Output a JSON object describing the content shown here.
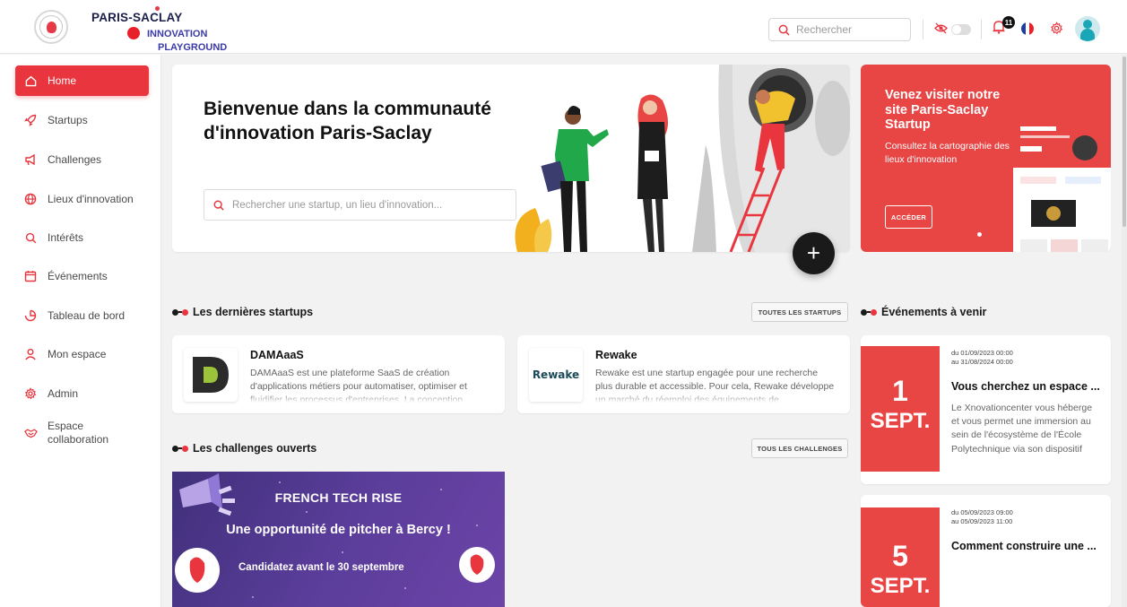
{
  "header": {
    "brand_line1": "PARIS-SACLAY",
    "brand_line2": "INNOVATION",
    "brand_line3": "PLAYGROUND",
    "search_placeholder": "Rechercher",
    "notification_count": "11"
  },
  "sidebar": {
    "items": [
      {
        "label": "Home",
        "icon": "home-icon",
        "active": true
      },
      {
        "label": "Startups",
        "icon": "rocket-icon"
      },
      {
        "label": "Challenges",
        "icon": "megaphone-icon"
      },
      {
        "label": "Lieux d'innovation",
        "icon": "globe-icon"
      },
      {
        "label": "Intérêts",
        "icon": "search-icon"
      },
      {
        "label": "Événements",
        "icon": "calendar-icon"
      },
      {
        "label": "Tableau de bord",
        "icon": "pie-chart-icon"
      },
      {
        "label": "Mon espace",
        "icon": "user-icon"
      },
      {
        "label": "Admin",
        "icon": "gear-icon"
      },
      {
        "label": "Espace collaboration",
        "icon": "handshake-icon"
      }
    ]
  },
  "hero": {
    "title": "Bienvenue dans la communauté d'innovation Paris-Saclay",
    "search_placeholder": "Rechercher une startup, un lieu d'innovation...",
    "fab_label": "+"
  },
  "promo": {
    "title": "Venez visiter notre site Paris-Saclay Startup",
    "description": "Consultez la cartographie des lieux d'innovation",
    "button": "ACCÉDER"
  },
  "startups": {
    "heading": "Les dernières startups",
    "all_button": "TOUTES LES STARTUPS",
    "cards": [
      {
        "name": "DAMAaaS",
        "description": "DAMAaaS est une plateforme SaaS de création d'applications métiers pour automatiser, optimiser et fluidifier les processus d'entreprises. La conception"
      },
      {
        "name": "Rewake",
        "logo_text": "Rewake",
        "description": "Rewake est une startup engagée pour une recherche plus durable et accessible. Pour cela, Rewake développe un marché du réemploi des équipements de"
      }
    ]
  },
  "challenges": {
    "heading": "Les challenges ouverts",
    "all_button": "TOUS LES CHALLENGES",
    "banner": {
      "title": "FRENCH TECH RISE",
      "subtitle": "Une opportunité de pitcher à Bercy !",
      "cta": "Candidatez avant le 30 septembre"
    }
  },
  "events": {
    "heading": "Événements à venir",
    "items": [
      {
        "day": "1",
        "month": "SEPT.",
        "from": "du 01/09/2023 00:00",
        "to": "au 31/08/2024 00:00",
        "title": "Vous cherchez un espace ...",
        "description": "Le Xnovationcenter vous héberge et vous permet une immersion au sein de l'écosystème de l'École Polytechnique via son dispositif"
      },
      {
        "day": "5",
        "month": "SEPT.",
        "from": "du 05/09/2023 09:00",
        "to": "au 05/09/2023 11:00",
        "title": "Comment construire une ...",
        "description": ""
      }
    ]
  },
  "colors": {
    "accent": "#e9353e",
    "brand_navy": "#1b1f4a",
    "brand_blue": "#3a3aa8"
  }
}
